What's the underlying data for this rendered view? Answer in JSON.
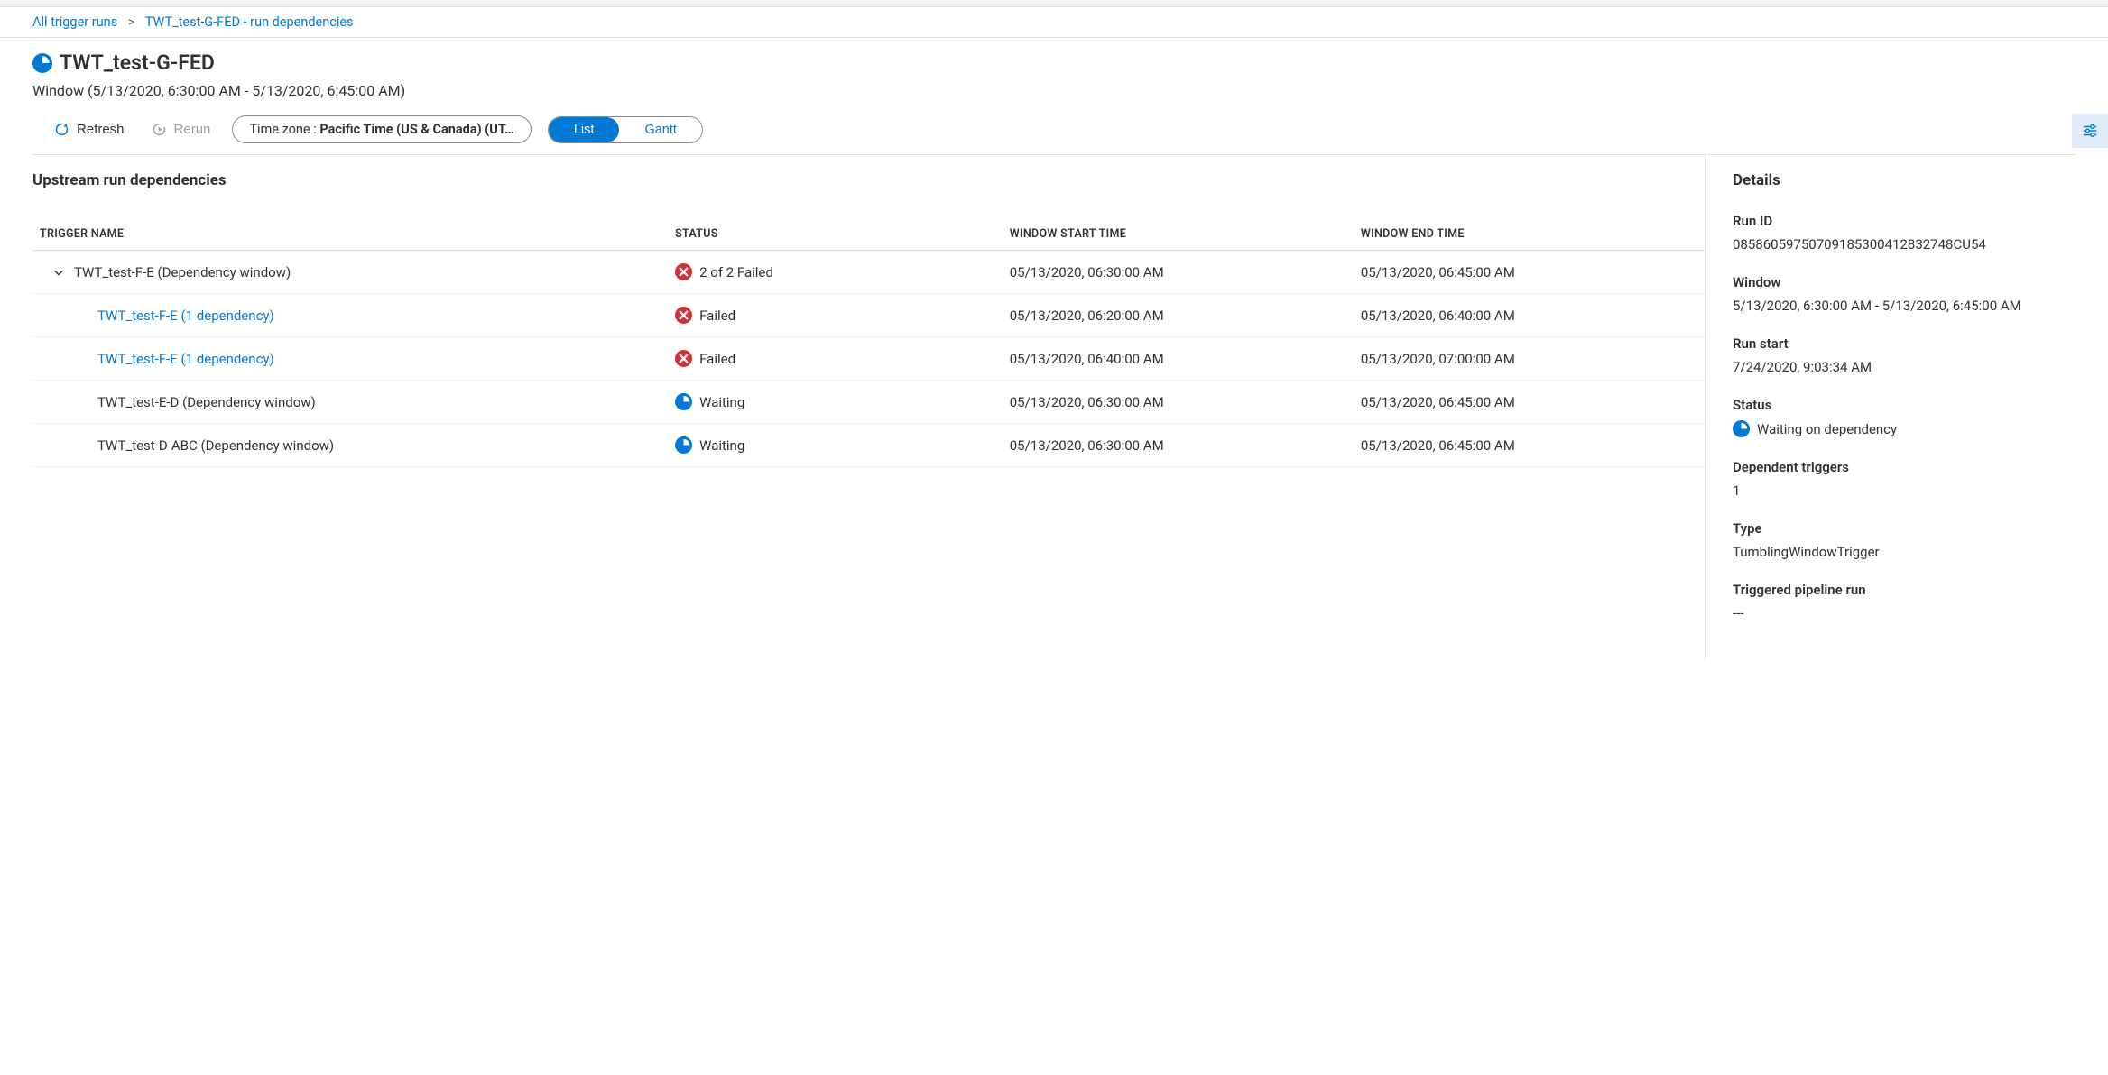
{
  "breadcrumb": {
    "root": "All trigger runs",
    "current": "TWT_test-G-FED - run dependencies"
  },
  "page_title": "TWT_test-G-FED",
  "window_text": "Window (5/13/2020, 6:30:00 AM - 5/13/2020, 6:45:00 AM)",
  "toolbar": {
    "refresh": "Refresh",
    "rerun": "Rerun",
    "timezone_label": "Time zone : ",
    "timezone_value": "Pacific Time (US & Canada) (UT…",
    "list": "List",
    "gantt": "Gantt"
  },
  "upstream_title": "Upstream run dependencies",
  "columns": {
    "trigger": "TRIGGER NAME",
    "status": "STATUS",
    "start": "WINDOW START TIME",
    "end": "WINDOW END TIME"
  },
  "rows": [
    {
      "name": "TWT_test-F-E (Dependency window)",
      "link": false,
      "expandable": true,
      "indent": 0,
      "status_kind": "failed",
      "status_text": "2 of 2 Failed",
      "start": "05/13/2020, 06:30:00 AM",
      "end": "05/13/2020, 06:45:00 AM"
    },
    {
      "name": "TWT_test-F-E (1 dependency)",
      "link": true,
      "expandable": false,
      "indent": 1,
      "status_kind": "failed",
      "status_text": "Failed",
      "start": "05/13/2020, 06:20:00 AM",
      "end": "05/13/2020, 06:40:00 AM"
    },
    {
      "name": "TWT_test-F-E (1 dependency)",
      "link": true,
      "expandable": false,
      "indent": 1,
      "status_kind": "failed",
      "status_text": "Failed",
      "start": "05/13/2020, 06:40:00 AM",
      "end": "05/13/2020, 07:00:00 AM"
    },
    {
      "name": "TWT_test-E-D (Dependency window)",
      "link": false,
      "expandable": false,
      "indent": 1,
      "status_kind": "waiting",
      "status_text": "Waiting",
      "start": "05/13/2020, 06:30:00 AM",
      "end": "05/13/2020, 06:45:00 AM"
    },
    {
      "name": "TWT_test-D-ABC (Dependency window)",
      "link": false,
      "expandable": false,
      "indent": 1,
      "status_kind": "waiting",
      "status_text": "Waiting",
      "start": "05/13/2020, 06:30:00 AM",
      "end": "05/13/2020, 06:45:00 AM"
    }
  ],
  "details": {
    "title": "Details",
    "run_id_label": "Run ID",
    "run_id": "08586059750709185300412832748CU54",
    "window_label": "Window",
    "window": "5/13/2020, 6:30:00 AM - 5/13/2020, 6:45:00 AM",
    "run_start_label": "Run start",
    "run_start": "7/24/2020, 9:03:34 AM",
    "status_label": "Status",
    "status_text": "Waiting on dependency",
    "dep_triggers_label": "Dependent triggers",
    "dep_triggers": "1",
    "type_label": "Type",
    "type": "TumblingWindowTrigger",
    "pipeline_label": "Triggered pipeline run",
    "pipeline": "---"
  }
}
